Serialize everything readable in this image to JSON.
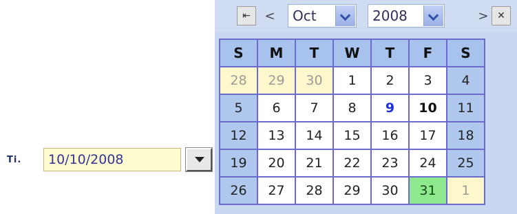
{
  "field": {
    "label": "Ti.",
    "value": "10/10/2008"
  },
  "calendar": {
    "nav_first": "⇤",
    "nav_prev": "<",
    "nav_next": ">",
    "close": "✕",
    "month": "Oct",
    "year": "2008",
    "weekdays": [
      "S",
      "M",
      "T",
      "W",
      "T",
      "F",
      "S"
    ],
    "weeks": [
      [
        {
          "d": "28",
          "c": "other"
        },
        {
          "d": "29",
          "c": "other"
        },
        {
          "d": "30",
          "c": "other"
        },
        {
          "d": "1",
          "c": "wd"
        },
        {
          "d": "2",
          "c": "wd"
        },
        {
          "d": "3",
          "c": "wd"
        },
        {
          "d": "4",
          "c": "we"
        }
      ],
      [
        {
          "d": "5",
          "c": "we"
        },
        {
          "d": "6",
          "c": "wd"
        },
        {
          "d": "7",
          "c": "wd"
        },
        {
          "d": "8",
          "c": "wd"
        },
        {
          "d": "9",
          "c": "wd today"
        },
        {
          "d": "10",
          "c": "wd selected"
        },
        {
          "d": "11",
          "c": "we"
        }
      ],
      [
        {
          "d": "12",
          "c": "we"
        },
        {
          "d": "13",
          "c": "wd"
        },
        {
          "d": "14",
          "c": "wd"
        },
        {
          "d": "15",
          "c": "wd"
        },
        {
          "d": "16",
          "c": "wd"
        },
        {
          "d": "17",
          "c": "wd"
        },
        {
          "d": "18",
          "c": "we"
        }
      ],
      [
        {
          "d": "19",
          "c": "we"
        },
        {
          "d": "20",
          "c": "wd"
        },
        {
          "d": "21",
          "c": "wd"
        },
        {
          "d": "22",
          "c": "wd"
        },
        {
          "d": "23",
          "c": "wd"
        },
        {
          "d": "24",
          "c": "wd"
        },
        {
          "d": "25",
          "c": "we"
        }
      ],
      [
        {
          "d": "26",
          "c": "we"
        },
        {
          "d": "27",
          "c": "wd"
        },
        {
          "d": "28",
          "c": "wd"
        },
        {
          "d": "29",
          "c": "wd"
        },
        {
          "d": "30",
          "c": "wd"
        },
        {
          "d": "31",
          "c": "hl"
        },
        {
          "d": "1",
          "c": "other"
        }
      ]
    ]
  },
  "colors": {
    "weekend": "#b0c8ee",
    "other_month": "#fdf8cc",
    "highlight": "#8ee88e",
    "today_text": "#1f2fe0"
  }
}
